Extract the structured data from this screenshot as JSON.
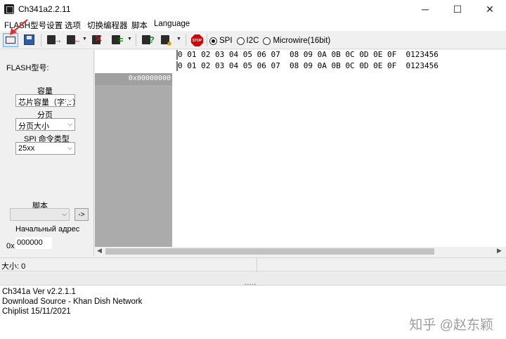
{
  "window": {
    "title": "Ch341a2.2.11",
    "minimize": "─",
    "maximize": "☐",
    "close": "✕"
  },
  "menu": {
    "items": [
      "FLASH型号设置",
      "选项",
      "切换编程器",
      "脚本",
      "Language"
    ]
  },
  "toolbar": {
    "icons": [
      "open-chip-icon",
      "save-icon",
      "read-icon",
      "write-icon",
      "erase-icon",
      "verify-icon",
      "detect-icon",
      "auto-icon",
      "stop-icon"
    ],
    "stop_label": "STOP",
    "protocols": [
      {
        "label": "SPI",
        "selected": true
      },
      {
        "label": "I2C",
        "selected": false
      },
      {
        "label": "Microwire(16bit)",
        "selected": false
      }
    ]
  },
  "left_panel": {
    "flash_model_label": "FLASH型号:",
    "capacity_label": "容量",
    "capacity_value": "芯片容量（字节）",
    "page_label": "分页",
    "page_value": "分页大小",
    "spi_cmd_label": "SPI 命令类型",
    "spi_cmd_value": "25xx",
    "script_label": "脚本",
    "script_button": "->",
    "start_address_label": "Начальный адрес",
    "address_prefix": "0x",
    "address_value": "000000"
  },
  "hex_view": {
    "header_row1": "0 01 02 03 04 05 06 07  08 09 0A 0B 0C 0D 0E 0F  0123456",
    "header_row2": "0 01 02 03 04 05 06 07  08 09 0A 0B 0C 0D 0E 0F  0123456",
    "first_address": "0x00000000"
  },
  "status": {
    "size_text": "大小: 0"
  },
  "log": {
    "lines": [
      "Ch341a Ver v2.2.1.1",
      "Download Source - Khan Dish Network",
      "Chiplist 15/11/2021"
    ],
    "watermark": "知乎 @赵东颖"
  },
  "colors": {
    "address_column": "#ababab",
    "stop": "#d40000",
    "annotation_arrow": "#e03030"
  }
}
